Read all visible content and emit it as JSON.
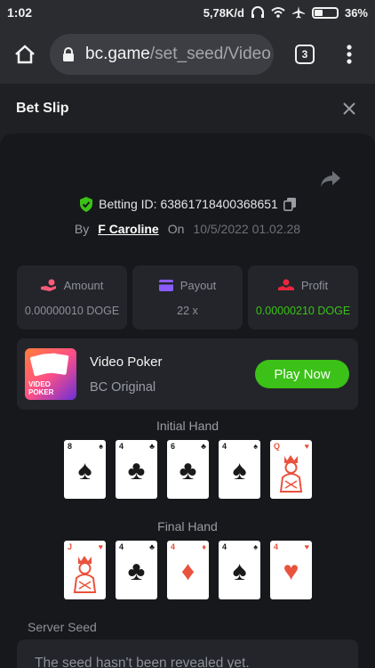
{
  "status_bar": {
    "time": "1:02",
    "speed": "5,78K/d",
    "battery": "36%"
  },
  "browser": {
    "url_host": "bc.game",
    "url_path": "/set_seed/Video",
    "tab_count": "3"
  },
  "slip": {
    "title": "Bet Slip",
    "betting_id_label": "Betting ID: ",
    "betting_id": "63861718400368651",
    "by_label": "By",
    "username": "F Caroline",
    "on_label": "On",
    "date": "10/5/2022 01.02.28"
  },
  "stats": [
    {
      "label": "Amount",
      "value": "0.00000010 DOGE",
      "icon": "coins-hand-icon"
    },
    {
      "label": "Payout",
      "value": "22 x",
      "icon": "wallet-icon"
    },
    {
      "label": "Profit",
      "value": "0.00000210 DOGE",
      "icon": "profit-hand-icon"
    }
  ],
  "game": {
    "thumb_text": "VIDEO POKER",
    "name": "Video Poker",
    "provider": "BC Original",
    "play_label": "Play Now"
  },
  "initial_hand": {
    "title": "Initial Hand",
    "cards": [
      {
        "rank": "8",
        "suit": "♠",
        "color": "black"
      },
      {
        "rank": "4",
        "suit": "♣",
        "color": "black"
      },
      {
        "rank": "6",
        "suit": "♣",
        "color": "black"
      },
      {
        "rank": "4",
        "suit": "♠",
        "color": "black"
      },
      {
        "rank": "Q",
        "suit": "♥",
        "color": "red",
        "face": true
      }
    ]
  },
  "final_hand": {
    "title": "Final Hand",
    "cards": [
      {
        "rank": "J",
        "suit": "♥",
        "color": "red",
        "face": true
      },
      {
        "rank": "4",
        "suit": "♣",
        "color": "black"
      },
      {
        "rank": "4",
        "suit": "♦",
        "color": "red"
      },
      {
        "rank": "4",
        "suit": "♠",
        "color": "black"
      },
      {
        "rank": "4",
        "suit": "♥",
        "color": "red"
      }
    ]
  },
  "server_seed": {
    "label": "Server Seed",
    "text": "The seed hasn't been revealed yet."
  },
  "colors": {
    "accent_green": "#3bc117",
    "panel": "#17181b",
    "card_tile": "#23252a"
  }
}
